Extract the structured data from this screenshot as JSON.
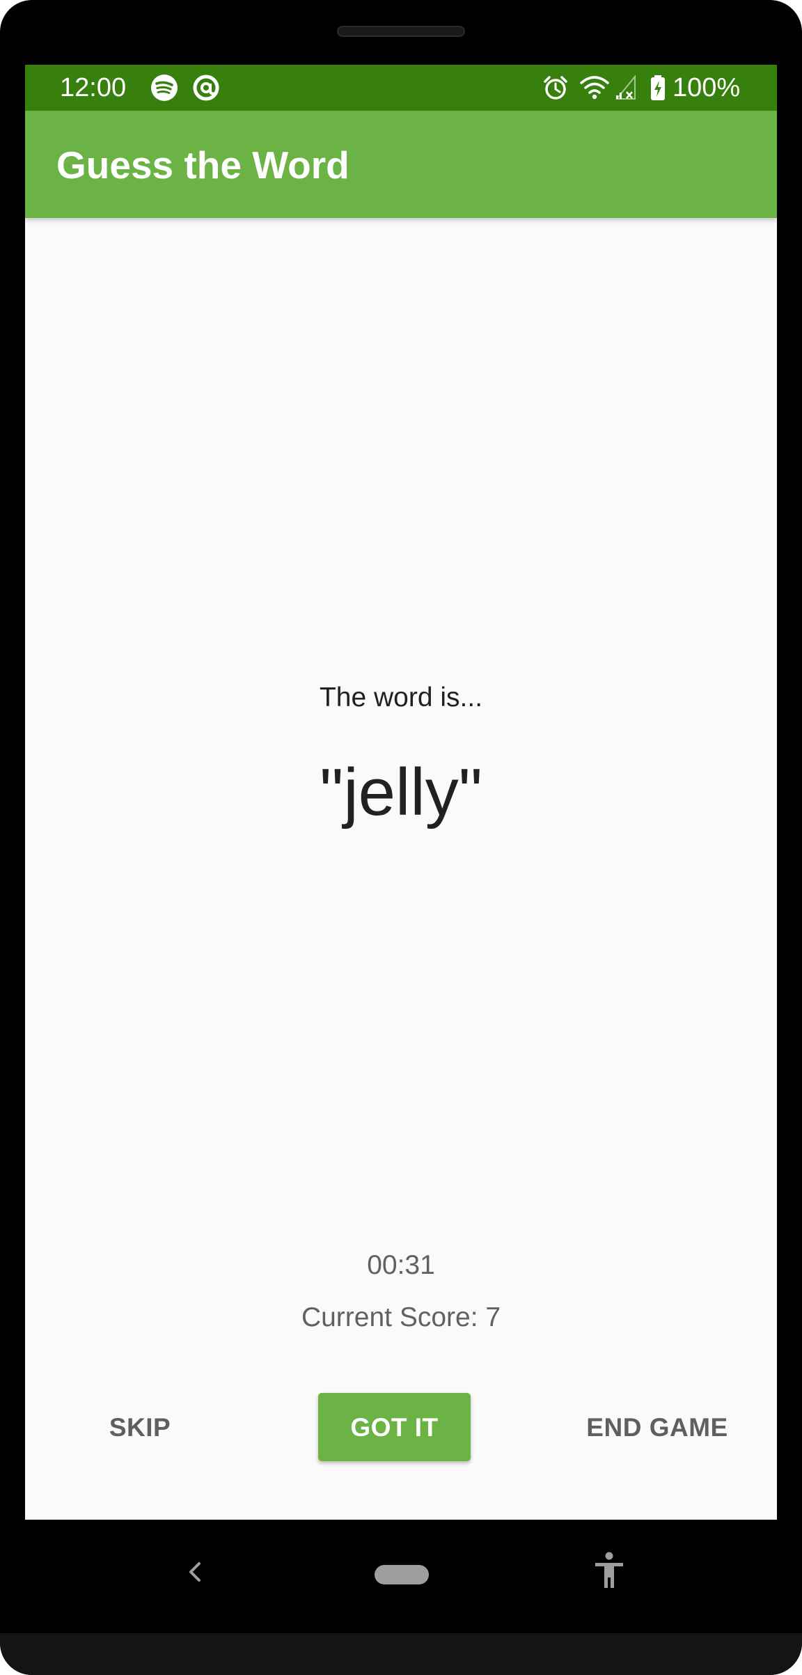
{
  "colors": {
    "status_bar": "#38800d",
    "app_bar": "#6ab344",
    "accent": "#6ab344",
    "background": "#fafafa"
  },
  "status_bar": {
    "time": "12:00",
    "battery": "100%",
    "icons": [
      "spotify-icon",
      "at-sign-icon",
      "alarm-icon",
      "wifi-icon",
      "cell-signal-icon",
      "battery-charging-icon"
    ]
  },
  "app_bar": {
    "title": "Guess the Word"
  },
  "game": {
    "word_prefix": "The word is...",
    "word": "\"jelly\"",
    "timer": "00:31",
    "score": "Current Score: 7"
  },
  "buttons": {
    "skip": "SKIP",
    "got_it": "GOT IT",
    "end_game": "END GAME"
  },
  "nav_bar": {
    "icons": [
      "back-icon",
      "home-pill-icon",
      "accessibility-icon"
    ]
  }
}
